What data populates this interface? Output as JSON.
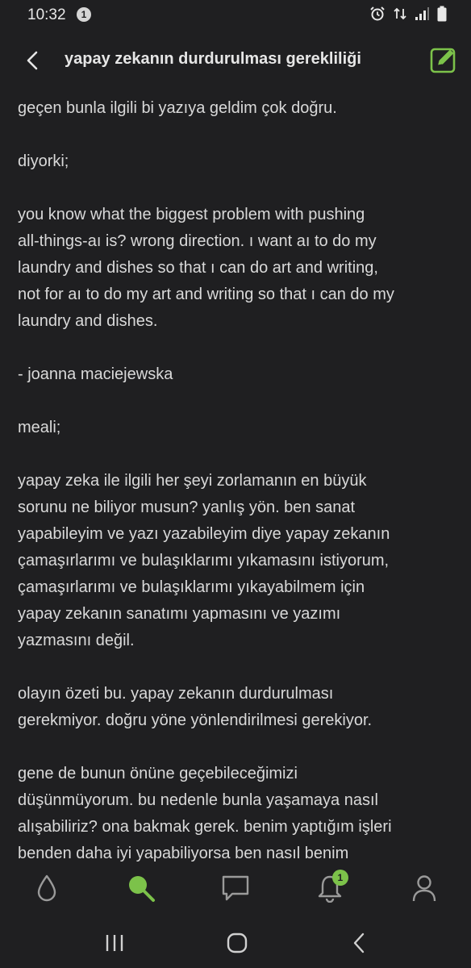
{
  "status_bar": {
    "time": "10:32",
    "notification_count": "1"
  },
  "header": {
    "title": "yapay zekanın durdurulması gerekliliği"
  },
  "content": {
    "paragraphs": [
      "geçen bunla ilgili bi yazıya geldim çok doğru.",
      "diyorki;",
      "you know what the biggest problem with pushing\nall-things-aı is? wrong direction. ı want aı to do my\nlaundry and dishes so that ı can do art and writing,\nnot for aı to do my art and writing so that ı can do my\nlaundry and dishes.",
      "- joanna maciejewska",
      "meali;",
      "yapay zeka ile ilgili her şeyi zorlamanın en büyük\nsorunu ne biliyor musun? yanlış yön. ben sanat\nyapabileyim ve yazı yazabileyim diye yapay zekanın\nçamaşırlarımı ve bulaşıklarımı yıkamasını istiyorum,\nçamaşırlarımı ve bulaşıklarımı yıkayabilmem için\nyapay zekanın sanatımı yapmasını ve yazımı\nyazmasını değil.",
      "olayın özeti bu. yapay zekanın durdurulması\ngerekmiyor. doğru yöne yönlendirilmesi gerekiyor.",
      "gene de bunun önüne geçebileceğimizi\ndüşünmüyorum. bu nedenle bunla yaşamaya nasıl\nalışabiliriz? ona bakmak gerek. benim yaptığım işleri\nbenden daha iyi yapabiliyorsa ben nasıl benim"
    ]
  },
  "bottom_nav": {
    "items": [
      {
        "icon": "drop-icon"
      },
      {
        "icon": "search-icon",
        "active": true
      },
      {
        "icon": "message-icon"
      },
      {
        "icon": "bell-icon",
        "badge": "1"
      },
      {
        "icon": "user-icon"
      }
    ]
  },
  "colors": {
    "accent": "#7cc24a",
    "background": "#1f1f21",
    "text": "#d9d9d9",
    "icon": "#9a9a9a"
  }
}
